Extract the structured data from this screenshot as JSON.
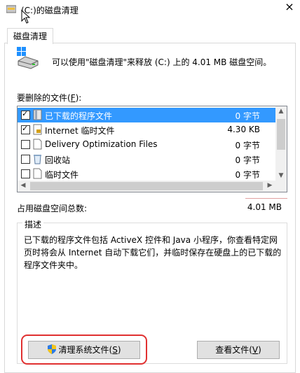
{
  "window": {
    "title": "(C:)的磁盘清理",
    "close_symbol": "×"
  },
  "tab": {
    "label": "磁盘清理"
  },
  "info": {
    "text": "可以使用\"磁盘清理\"来释放 (C:) 上的 4.01 MB 磁盘空间。"
  },
  "files": {
    "label_prefix": "要删除的文件(",
    "label_key": "F",
    "label_suffix": "):",
    "items": [
      {
        "name": "已下载的程序文件",
        "size": "0 字节",
        "checked": true,
        "selected": true,
        "icon": "folder-icon"
      },
      {
        "name": "Internet 临时文件",
        "size": "4.30 KB",
        "checked": true,
        "selected": false,
        "icon": "lock-file-icon"
      },
      {
        "name": "Delivery Optimization Files",
        "size": "0 字节",
        "checked": false,
        "selected": false,
        "icon": "file-icon"
      },
      {
        "name": "回收站",
        "size": "0 字节",
        "checked": false,
        "selected": false,
        "icon": "recycle-bin-icon"
      },
      {
        "name": "临时文件",
        "size": "0 字节",
        "checked": false,
        "selected": false,
        "icon": "file-icon"
      }
    ]
  },
  "total": {
    "label": "占用磁盘空间总数:",
    "value": "4.01 MB"
  },
  "description": {
    "title": "描述",
    "text": "已下载的程序文件包括 ActiveX 控件和 Java 小程序，你查看特定网页时将会从 Internet 自动下载它们，并临时保存在硬盘上的已下载的程序文件夹中。"
  },
  "buttons": {
    "clean_prefix": "清理系统文件(",
    "clean_key": "S",
    "clean_suffix": ")",
    "view_prefix": "查看文件(",
    "view_key": "V",
    "view_suffix": ")"
  },
  "colors": {
    "selection": "#3399ff",
    "highlight_ring": "#e03030"
  }
}
